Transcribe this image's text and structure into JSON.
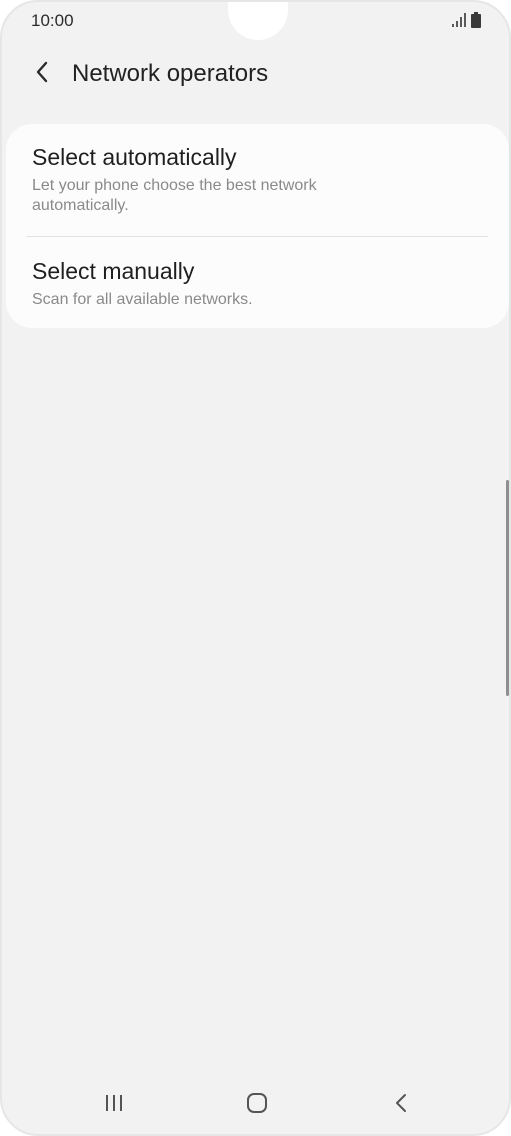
{
  "status_bar": {
    "time": "10:00",
    "icons": [
      "signal-icon",
      "battery-icon"
    ]
  },
  "header": {
    "back_icon": "chevron-left-icon",
    "title": "Network operators"
  },
  "options": [
    {
      "title": "Select automatically",
      "description": "Let your phone choose the best network automatically."
    },
    {
      "title": "Select manually",
      "description": "Scan for all available networks."
    }
  ],
  "nav_bar": {
    "icons": [
      "recent-apps-icon",
      "home-icon",
      "back-icon"
    ]
  },
  "colors": {
    "background": "#f2f2f2",
    "card": "#fcfcfc",
    "title_text": "#222222",
    "secondary_text": "#8a8a8a"
  }
}
